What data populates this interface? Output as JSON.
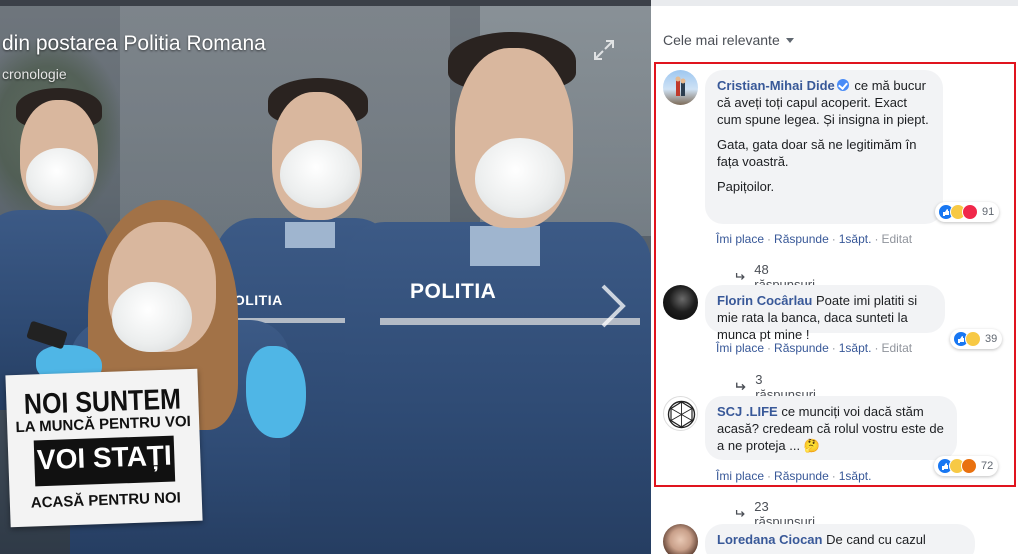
{
  "viewer": {
    "title": "din postarea Politia Romana",
    "subtitle": "cronologie",
    "sign": {
      "line1": "NOI SUNTEM",
      "line2": "LA MUNCĂ PENTRU VOI",
      "line3": "VOI STAȚI",
      "line4": "ACASĂ PENTRU NOI"
    },
    "badge_left": "POLITIA",
    "badge_right": "POLITIA"
  },
  "panel": {
    "sort_label": "Cele mai relevante",
    "comments": [
      {
        "author": "Cristian-Mihai Dide",
        "verified": true,
        "paragraphs": [
          "ce mă bucur că aveți toți capul acoperit. Exact cum spune legea. Și insigna in piept.",
          "Gata, gata doar să ne legitimăm în fața voastră.",
          "Papițoilor."
        ],
        "reaction_count": "91",
        "reactions": [
          "like",
          "haha",
          "love"
        ],
        "actions": {
          "like": "Îmi place",
          "reply": "Răspunde",
          "time": "1săpt.",
          "edited": "Editat"
        },
        "replies": "48 răspunsuri"
      },
      {
        "author": "Florin Cocârlau",
        "verified": false,
        "paragraphs": [
          "Poate imi platiti si mie rata la banca, daca sunteti la munca pt mine !"
        ],
        "reaction_count": "39",
        "reactions": [
          "like",
          "haha"
        ],
        "actions": {
          "like": "Îmi place",
          "reply": "Răspunde",
          "time": "1săpt.",
          "edited": "Editat"
        },
        "replies": "3 răspunsuri"
      },
      {
        "author": "SCJ .LIFE",
        "verified": false,
        "paragraphs": [
          "ce munciți voi dacă stăm acasă? credeam că rolul vostru este de a ne proteja ... 🤔"
        ],
        "reaction_count": "72",
        "reactions": [
          "like",
          "haha",
          "angry"
        ],
        "actions": {
          "like": "Îmi place",
          "reply": "Răspunde",
          "time": "1săpt."
        },
        "replies": "23 răspunsuri"
      },
      {
        "author": "Loredana Ciocan",
        "verified": false,
        "paragraphs": [
          "De cand cu cazul"
        ]
      }
    ]
  },
  "colors": {
    "link": "#385898",
    "bubble": "#f2f3f5",
    "highlight": "#e0141e"
  }
}
